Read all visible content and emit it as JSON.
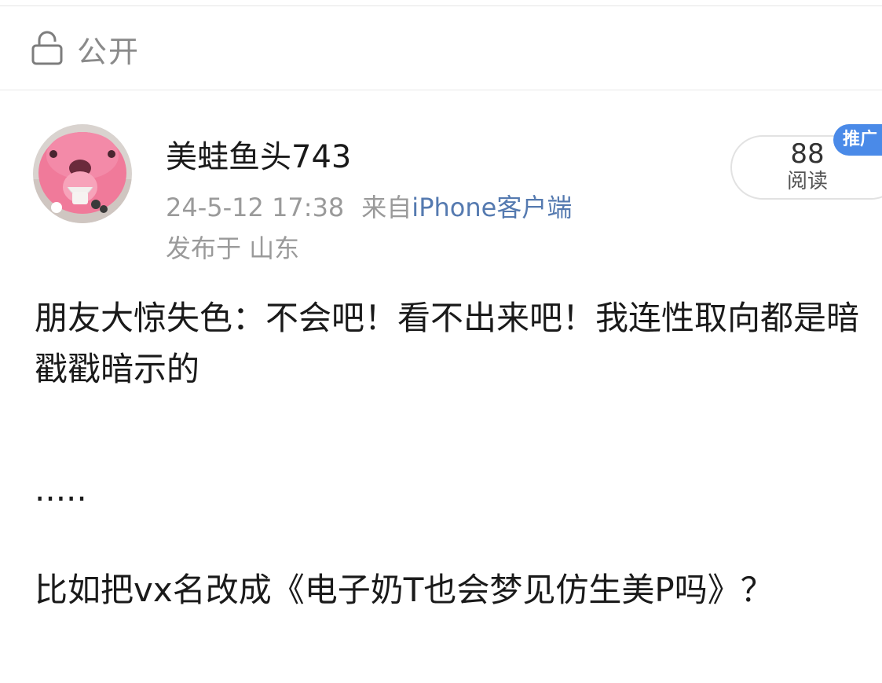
{
  "privacy": {
    "label": "公开",
    "icon": "lock-open-icon"
  },
  "author": {
    "name": "美蛙鱼头743",
    "avatar": "pink-character-avatar"
  },
  "meta": {
    "timestamp": "24-5-12 17:38",
    "source_prefix": "来自",
    "client": "iPhone客户端",
    "location": "发布于 山东"
  },
  "reads": {
    "count": "88",
    "label": "阅读",
    "badge": "推广"
  },
  "post": {
    "paragraph1": "朋友大惊失色：不会吧！看不出来吧！我连性取向都是暗戳戳暗示的",
    "paragraph2": ".....",
    "paragraph3": "比如把vx名改成《电子奶T也会梦见仿生美P吗》？"
  },
  "colors": {
    "link": "#557ab0",
    "badge": "#4a8ae8",
    "muted": "#9a9a9a"
  }
}
